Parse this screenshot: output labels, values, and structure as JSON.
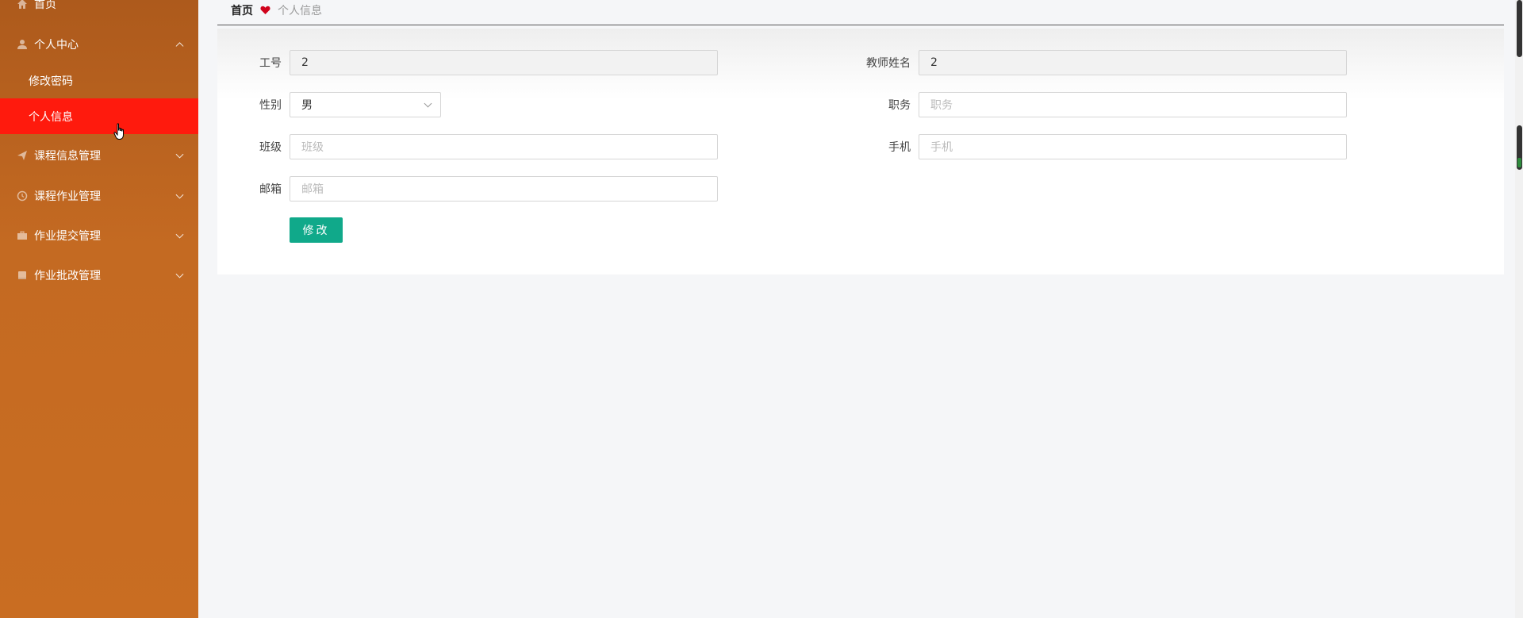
{
  "sidebar": {
    "items": [
      {
        "label": "首页",
        "icon": "home-icon"
      },
      {
        "label": "个人中心",
        "icon": "user-icon",
        "expanded": true,
        "children": [
          {
            "label": "修改密码",
            "active": false
          },
          {
            "label": "个人信息",
            "active": true
          }
        ]
      },
      {
        "label": "课程信息管理",
        "icon": "send-icon"
      },
      {
        "label": "课程作业管理",
        "icon": "clock-icon"
      },
      {
        "label": "作业提交管理",
        "icon": "briefcase-icon"
      },
      {
        "label": "作业批改管理",
        "icon": "book-icon"
      }
    ]
  },
  "breadcrumb": {
    "home": "首页",
    "separator_icon": "heart-icon",
    "current": "个人信息"
  },
  "form": {
    "gonghao": {
      "label": "工号",
      "value": "2"
    },
    "teacher_name": {
      "label": "教师姓名",
      "value": "2"
    },
    "gender": {
      "label": "性别",
      "value": "男"
    },
    "position": {
      "label": "职务",
      "placeholder": "职务"
    },
    "class": {
      "label": "班级",
      "placeholder": "班级"
    },
    "phone": {
      "label": "手机",
      "placeholder": "手机"
    },
    "email": {
      "label": "邮箱",
      "placeholder": "邮箱"
    },
    "submit_label": "修改"
  },
  "colors": {
    "sidebar_bg": "#c46a22",
    "active_item_bg": "#ff1a0d",
    "submit_button": "#10a98a",
    "heart": "#d0021b"
  }
}
